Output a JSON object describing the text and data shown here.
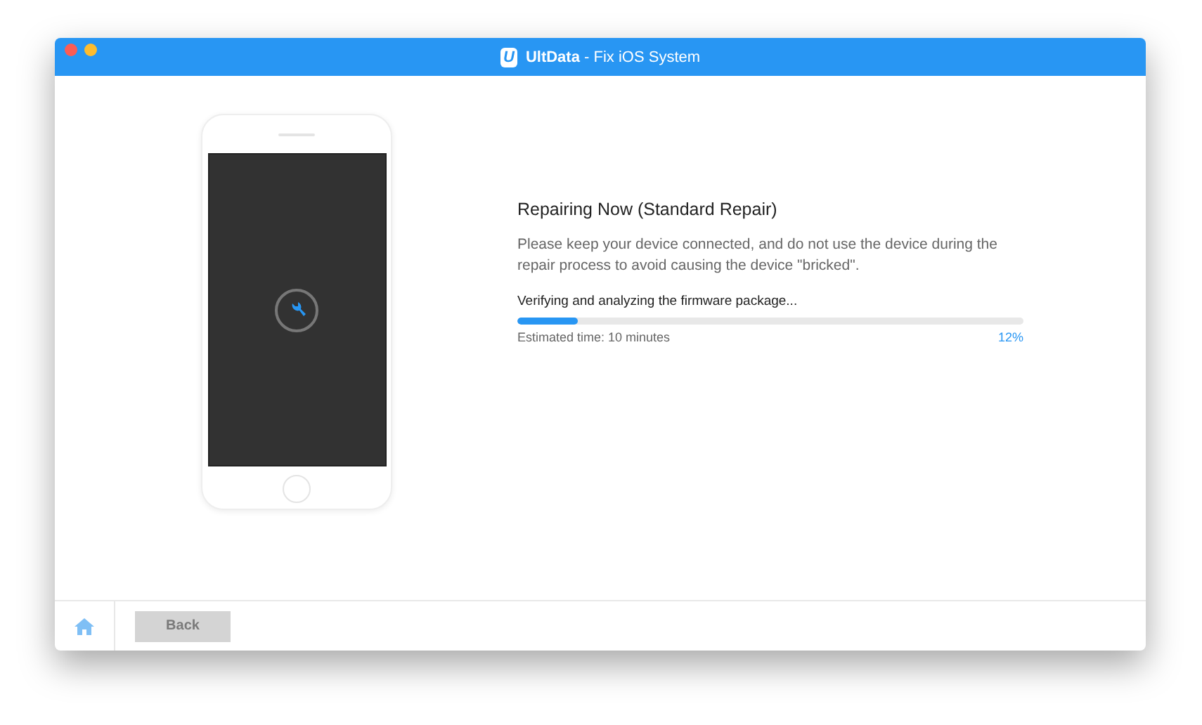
{
  "window": {
    "logo": "U",
    "title": "**UltData** - Fix iOS System"
  },
  "repair": {
    "heading": "Repairing Now (Standard Repair)",
    "description": "Please keep your device connected, and do not use the device during the repair process to avoid causing the device \"bricked\".",
    "status": "Verifying and analyzing the firmware package...",
    "progress": {
      "level": 0.12,
      "estimate": "Estimated time: 10 minutes",
      "percent": "12%"
    }
  },
  "footer": {
    "back_button": {
      "label": "Back",
      "disabled": true
    }
  }
}
